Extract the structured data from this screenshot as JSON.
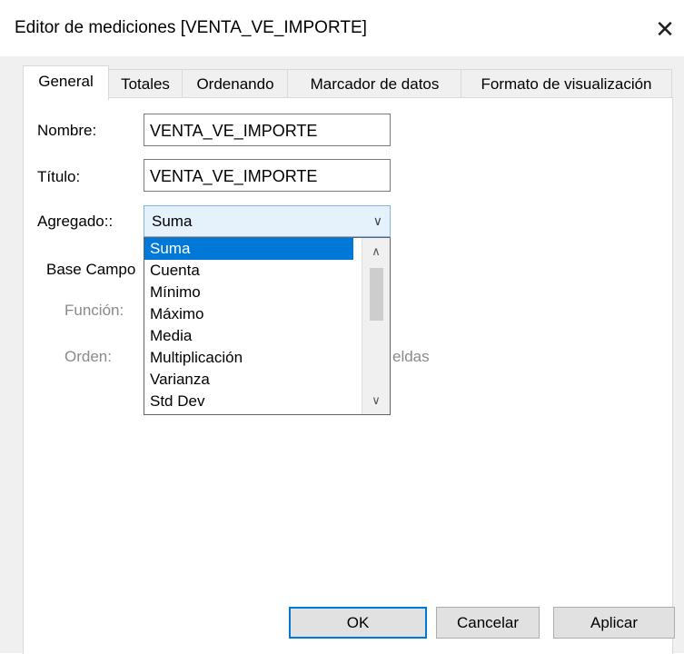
{
  "window": {
    "title": "Editor de mediciones [VENTA_VE_IMPORTE]",
    "close_glyph": "✕"
  },
  "tabs": [
    {
      "label": "General",
      "active": true
    },
    {
      "label": "Totales",
      "active": false
    },
    {
      "label": "Ordenando",
      "active": false
    },
    {
      "label": "Marcador de datos",
      "active": false
    },
    {
      "label": "Formato de visualización",
      "active": false
    }
  ],
  "general": {
    "nombre_label": "Nombre:",
    "nombre_value": "VENTA_VE_IMPORTE",
    "titulo_label": "Título:",
    "titulo_value": "VENTA_VE_IMPORTE",
    "agregado_label": "Agregado::",
    "agregado_value": "Suma",
    "base_campo_label": "Base Campo",
    "funcion_label": "Función:",
    "orden_label": "Orden:",
    "celdas_fragment": "eldas"
  },
  "dropdown": {
    "options": [
      "Suma",
      "Cuenta",
      "Mínimo",
      "Máximo",
      "Media",
      "Multiplicación",
      "Varianza",
      "Std Dev"
    ],
    "selected": "Suma"
  },
  "buttons": {
    "ok": "OK",
    "cancel": "Cancelar",
    "apply": "Aplicar"
  },
  "colors": {
    "accent": "#0078d7",
    "combo_bg": "#e5f1fb",
    "dialog_bg": "#f0f0f0"
  }
}
